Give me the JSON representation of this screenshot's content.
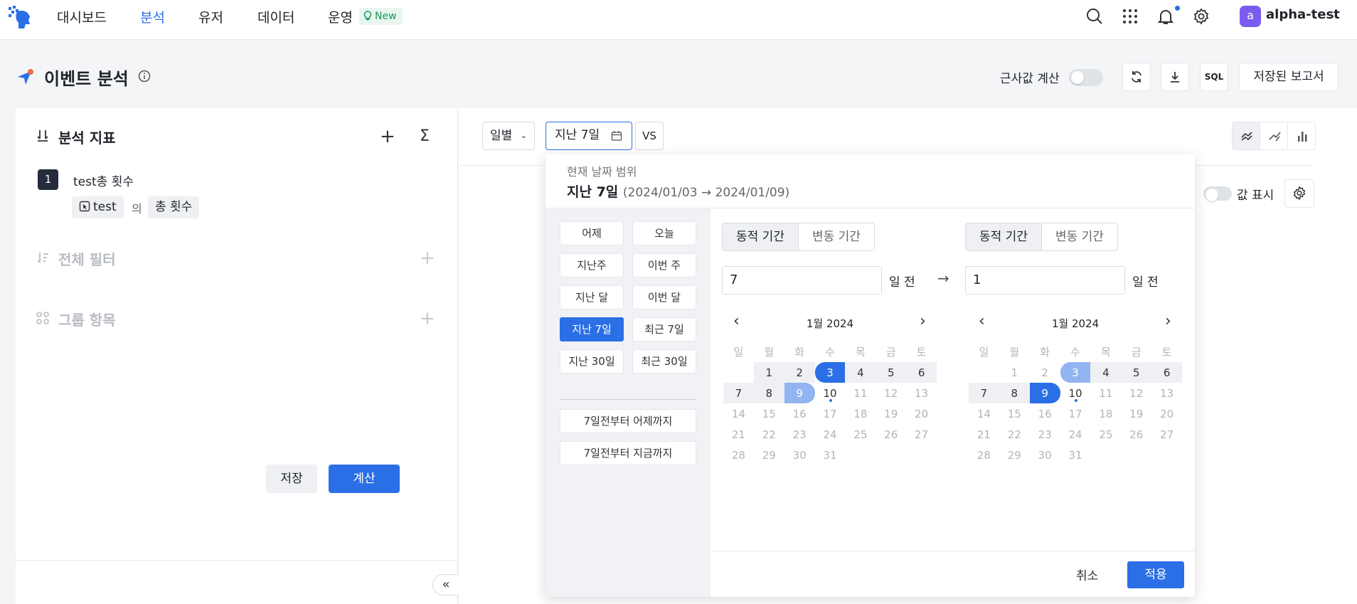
{
  "nav": {
    "items": [
      {
        "label": "대시보드",
        "active": false
      },
      {
        "label": "분석",
        "active": true
      },
      {
        "label": "유저",
        "active": false
      },
      {
        "label": "데이터",
        "active": false
      },
      {
        "label": "운영",
        "active": false
      }
    ],
    "new_badge": "New",
    "user": {
      "avatar_letter": "a",
      "name": "alpha-test"
    }
  },
  "header": {
    "title": "이벤트 분석",
    "approx_label": "근사값 계산",
    "sql_label": "SQL",
    "saved_reports_label": "저장된 보고서"
  },
  "left_panel": {
    "metrics_title": "분석 지표",
    "metric": {
      "index": "1",
      "name": "test총 횟수",
      "event_chip": "test",
      "of_label": "의",
      "measure_chip": "총 횟수"
    },
    "filter_title": "전체 필터",
    "group_title": "그룹 항목",
    "save_label": "저장",
    "calc_label": "계산",
    "collapse_label": "«"
  },
  "toolbar": {
    "unit_select": "일별",
    "date_select": "지난 7일",
    "vs_label": "VS",
    "value_display_label": "값 표시"
  },
  "date_picker": {
    "current_range_label": "현재 날짜 범위",
    "current_range_value": "지난 7일",
    "current_range_dates": "(2024/01/03 → 2024/01/09)",
    "presets": [
      [
        "어제",
        "오늘"
      ],
      [
        "지난주",
        "이번 주"
      ],
      [
        "지난 달",
        "이번 달"
      ],
      [
        "지난 7일",
        "최근 7일"
      ],
      [
        "지난 30일",
        "최근 30일"
      ]
    ],
    "active_preset": "지난 7일",
    "wide_presets": [
      "7일전부터 어제까지",
      "7일전부터 지금까지"
    ],
    "seg_dynamic": "동적 기간",
    "seg_fixed": "변동 기간",
    "start_days": "7",
    "end_days": "1",
    "days_suffix": "일 전",
    "month_title": "1월 2024",
    "weekdays": [
      "일",
      "월",
      "화",
      "수",
      "목",
      "금",
      "토"
    ],
    "weeks": [
      [
        "",
        "1",
        "2",
        "3",
        "4",
        "5",
        "6"
      ],
      [
        "7",
        "8",
        "9",
        "10",
        "11",
        "12",
        "13"
      ],
      [
        "14",
        "15",
        "16",
        "17",
        "18",
        "19",
        "20"
      ],
      [
        "21",
        "22",
        "23",
        "24",
        "25",
        "26",
        "27"
      ],
      [
        "28",
        "29",
        "30",
        "31",
        "",
        "",
        ""
      ]
    ],
    "cancel_label": "취소",
    "apply_label": "적용"
  },
  "colors": {
    "primary": "#2b6fe6",
    "soft_selected": "#92b4f0",
    "new_badge": "#1a9a5c"
  }
}
